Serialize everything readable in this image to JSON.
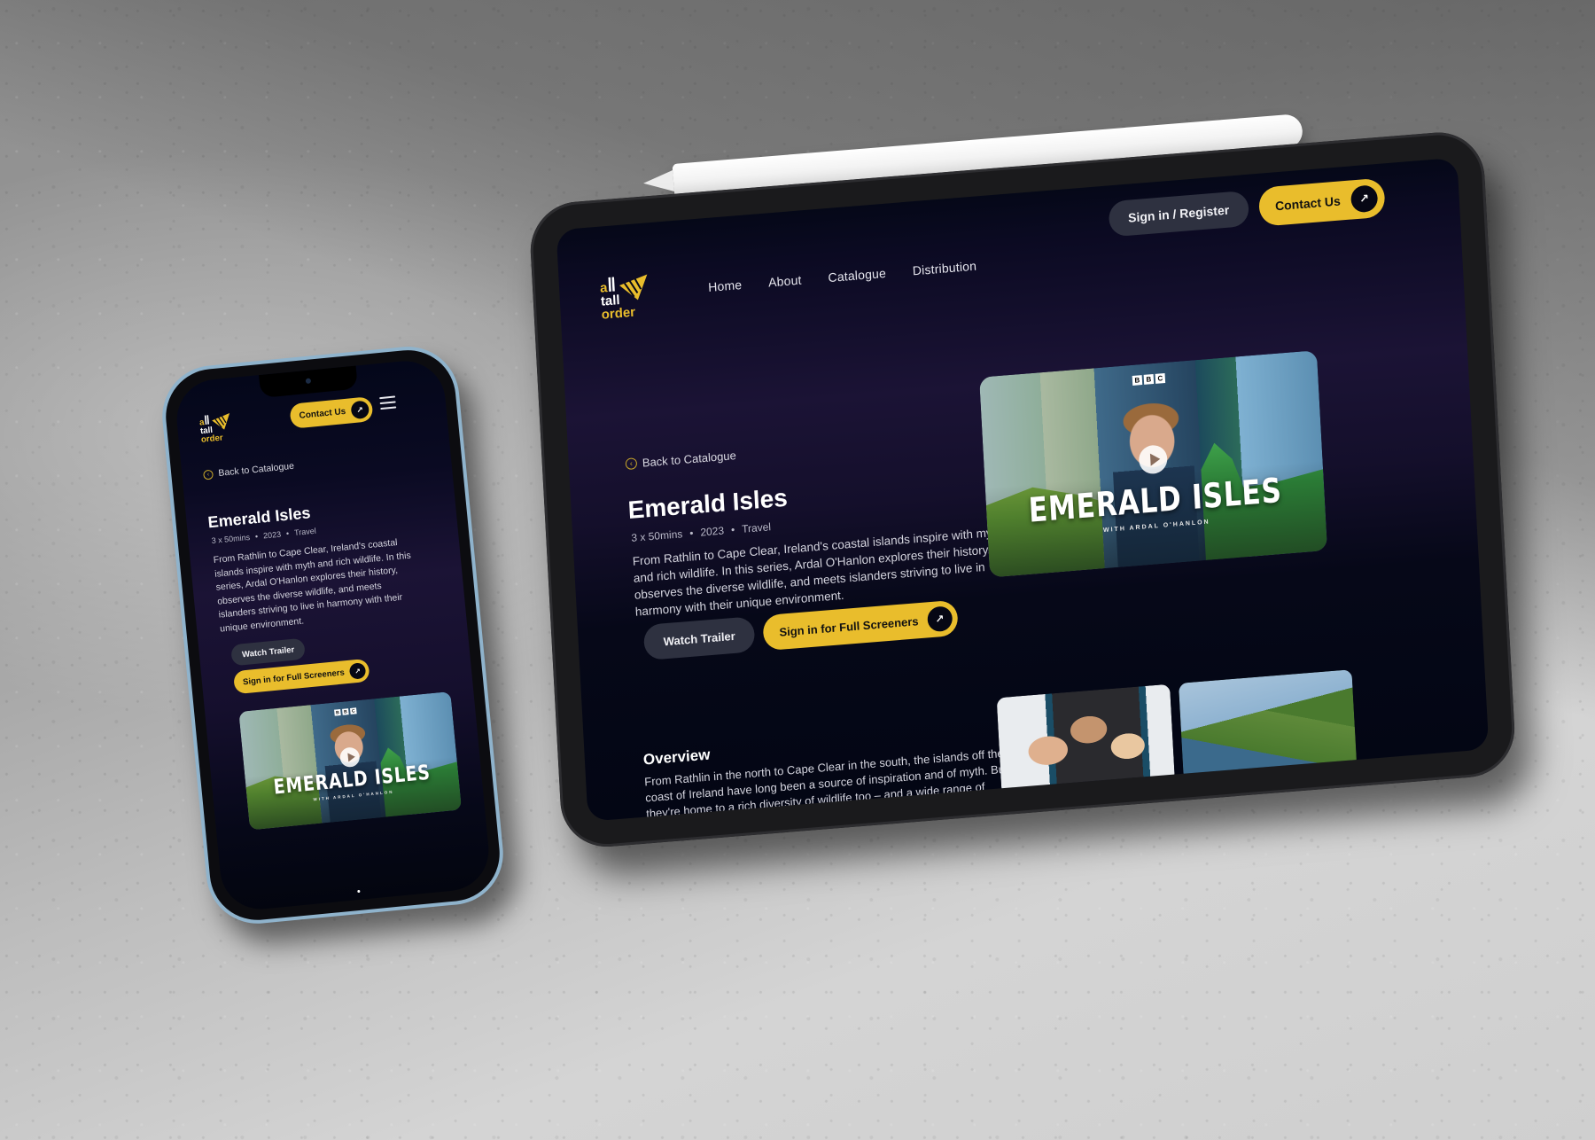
{
  "brand": {
    "logo_lines": [
      "a",
      "tall",
      "order"
    ],
    "accent": "#e9bd2c",
    "dark_button": "#2e3140",
    "bg_dark": "#060818",
    "bg_purple": "#1b1335"
  },
  "nav": {
    "items": [
      {
        "label": "Home"
      },
      {
        "label": "About"
      },
      {
        "label": "Catalogue"
      },
      {
        "label": "Distribution"
      }
    ],
    "signin_label": "Sign in / Register",
    "contact_label": "Contact Us",
    "contact_icon": "arrow-up-right-icon",
    "menu_icon": "hamburger-menu-icon"
  },
  "detail": {
    "back_label": "Back to Catalogue",
    "back_icon": "chevron-left-icon",
    "title": "Emerald Isles",
    "meta": {
      "episodes": "3 x 50mins",
      "year": "2023",
      "genre": "Travel"
    },
    "description": "From Rathlin to Cape Clear, Ireland's coastal islands inspire with myth and rich wildlife. In this series, Ardal O'Hanlon explores their history, observes the diverse wildlife, and meets islanders striving to live in harmony with their unique environment.",
    "watch_trailer_label": "Watch Trailer",
    "screeners_label": "Sign in for Full Screeners",
    "screeners_icon": "arrow-up-right-icon"
  },
  "poster": {
    "network": [
      "B",
      "B",
      "C"
    ],
    "title": "EMERALD ISLES",
    "subtitle": "WITH ARDAL O'HANLON",
    "play_icon": "play-icon"
  },
  "overview": {
    "heading": "Overview",
    "text": "From Rathlin in the north to Cape Clear in the south, the islands off the coast of Ireland have long been a source of inspiration and of myth. But they're home to a rich diversity of wildlife too – and a wide range of"
  },
  "gallery": [
    {
      "alt": "presenter-with-islanders-photo"
    },
    {
      "alt": "coastal-village-photo"
    }
  ]
}
